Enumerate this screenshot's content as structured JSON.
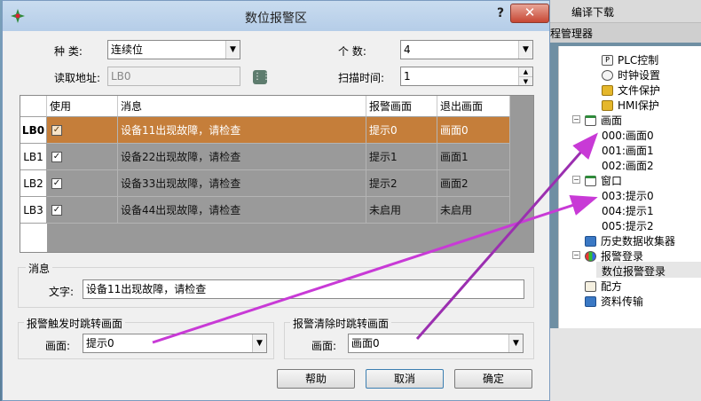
{
  "dialog": {
    "title": "数位报警区",
    "help": "?",
    "close": "✕",
    "type_label": "种    类:",
    "type_value": "连续位",
    "count_label": "个    数:",
    "count_value": "4",
    "address_label": "读取地址:",
    "address_value": "LB0",
    "scan_label": "扫描时间:",
    "scan_value": "1"
  },
  "grid": {
    "headers": [
      "使用",
      "消息",
      "报警画面",
      "退出画面"
    ],
    "rows": [
      {
        "id": "LB0",
        "message": "设备11出现故障，请检查",
        "alarm_screen": "提示0",
        "exit_screen": "画面0",
        "checked": true
      },
      {
        "id": "LB1",
        "message": "设备22出现故障，请检查",
        "alarm_screen": "提示1",
        "exit_screen": "画面1",
        "checked": true
      },
      {
        "id": "LB2",
        "message": "设备33出现故障，请检查",
        "alarm_screen": "提示2",
        "exit_screen": "画面2",
        "checked": true
      },
      {
        "id": "LB3",
        "message": "设备44出现故障，请检查",
        "alarm_screen": "未启用",
        "exit_screen": "未启用",
        "checked": true
      }
    ]
  },
  "message_group": {
    "title": "消息",
    "text_label": "文字:",
    "text_value": "设备11出现故障，请检查"
  },
  "trigger_group": {
    "title": "报警触发时跳转画面",
    "screen_label": "画面:",
    "screen_value": "提示0"
  },
  "clear_group": {
    "title": "报警清除时跳转画面",
    "screen_label": "画面:",
    "screen_value": "画面0"
  },
  "buttons": {
    "help": "帮助",
    "cancel": "取消",
    "ok": "确定"
  },
  "toolbar": {
    "download": "编译下载"
  },
  "panel": {
    "title": "程管理器"
  },
  "tree": {
    "plc": "PLC控制",
    "clock": "时钟设置",
    "file_protect": "文件保护",
    "hmi_protect": "HMI保护",
    "screens": "画面",
    "screen0": "000:画面0",
    "screen1": "001:画面1",
    "screen2": "002:画面2",
    "windows": "窗口",
    "win0": "003:提示0",
    "win1": "004:提示1",
    "win2": "005:提示2",
    "history": "历史数据收集器",
    "alarm": "报警登录",
    "bit_alarm": "数位报警登录",
    "recipe": "配方",
    "transfer": "资料传输"
  },
  "colors": {
    "highlight_row": "#c57e3a",
    "arrow": "#c83ad6"
  }
}
